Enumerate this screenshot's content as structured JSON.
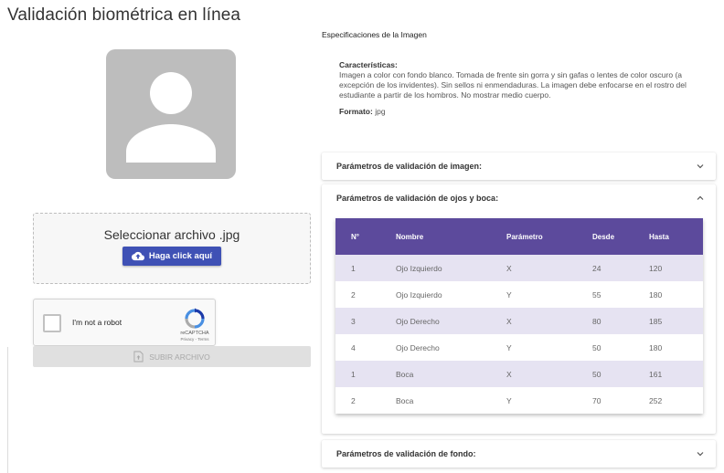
{
  "page": {
    "title": "Validación biométrica en línea"
  },
  "upload": {
    "file_label": "Seleccionar archivo .jpg",
    "button_label": "Haga click aquí"
  },
  "captcha": {
    "label": "I'm not a robot",
    "brand": "reCAPTCHA",
    "terms": "Privacy - Terms"
  },
  "submit": {
    "label": "SUBIR ARCHIVO"
  },
  "specs": {
    "title": "Especificaciones de la Imagen",
    "characteristics_label": "Características:",
    "characteristics_text": "Imagen a color con fondo blanco. Tomada de frente sin gorra y sin gafas o lentes de color oscuro (a excepción de los invidentes). Sin sellos ni enmendaduras. La imagen debe enfocarse en el rostro del estudiante a partir de los hombros. No mostrar medio cuerpo.",
    "format_label": "Formato:",
    "format_value": "jpg"
  },
  "panels": [
    {
      "title": "Parámetros de validación de imagen:",
      "expanded": false
    },
    {
      "title": "Parámetros de validación de ojos y boca:",
      "expanded": true
    },
    {
      "title": "Parámetros de validación de fondo:",
      "expanded": false
    }
  ],
  "table": {
    "headers": [
      "N°",
      "Nombre",
      "Parámetro",
      "Desde",
      "Hasta"
    ],
    "rows": [
      [
        "1",
        "Ojo Izquierdo",
        "X",
        "24",
        "120"
      ],
      [
        "2",
        "Ojo Izquierdo",
        "Y",
        "55",
        "180"
      ],
      [
        "3",
        "Ojo Derecho",
        "X",
        "80",
        "185"
      ],
      [
        "4",
        "Ojo Derecho",
        "Y",
        "50",
        "180"
      ],
      [
        "1",
        "Boca",
        "X",
        "50",
        "161"
      ],
      [
        "2",
        "Boca",
        "Y",
        "70",
        "252"
      ]
    ]
  },
  "colors": {
    "primary_button": "#3f51b5",
    "table_header": "#5c4a9c",
    "table_stripe": "#e6e3f2",
    "avatar_bg": "#bdbdbd"
  },
  "icons": {
    "upload": "cloud-upload-icon",
    "submit": "file-upload-icon",
    "collapse": "chevron-down-icon",
    "expand": "chevron-up-icon",
    "avatar": "person-placeholder-icon"
  }
}
